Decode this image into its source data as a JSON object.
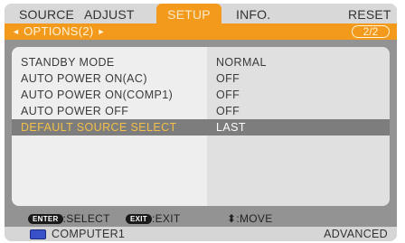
{
  "tabs": [
    {
      "label": "SOURCE",
      "active": false
    },
    {
      "label": "ADJUST",
      "active": false
    },
    {
      "label": "SETUP",
      "active": true
    },
    {
      "label": "INFO.",
      "active": false
    },
    {
      "label": "RESET",
      "active": false
    }
  ],
  "subheader": {
    "left_arrow": "◄",
    "title": "OPTIONS(2)",
    "right_arrow": "►",
    "page_indicator": "2/2"
  },
  "options": [
    {
      "label": "STANDBY MODE",
      "value": "NORMAL",
      "selected": false
    },
    {
      "label": "AUTO POWER ON(AC)",
      "value": "OFF",
      "selected": false
    },
    {
      "label": "AUTO POWER ON(COMP1)",
      "value": "OFF",
      "selected": false
    },
    {
      "label": "AUTO POWER OFF",
      "value": "OFF",
      "selected": false
    },
    {
      "label": "DEFAULT SOURCE SELECT",
      "value": "LAST",
      "selected": true
    }
  ],
  "hints": {
    "enter_key": "ENTER",
    "enter_text": ":SELECT",
    "exit_key": "EXIT",
    "exit_text": ":EXIT",
    "move_glyph": "⬍",
    "move_text": ":MOVE"
  },
  "status": {
    "source_icon": "computer-input-icon",
    "source": "COMPUTER1",
    "mode": "ADVANCED"
  },
  "colors": {
    "accent": "#f39a1d",
    "highlight_text": "#f3c04a",
    "frame": "#939393"
  }
}
